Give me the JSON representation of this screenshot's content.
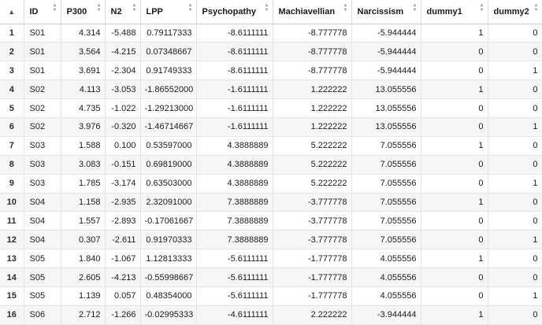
{
  "table": {
    "columns": [
      {
        "label": "",
        "icon": "sort-triangle-icon"
      },
      {
        "label": "ID"
      },
      {
        "label": "P300"
      },
      {
        "label": "N2"
      },
      {
        "label": "LPP"
      },
      {
        "label": "Psychopathy"
      },
      {
        "label": "Machiavellian"
      },
      {
        "label": "Narcissism"
      },
      {
        "label": "dummy1"
      },
      {
        "label": "dummy2"
      }
    ],
    "rows": [
      [
        "1",
        "S01",
        "4.314",
        "-5.488",
        "0.79117333",
        "-8.6111111",
        "-8.777778",
        "-5.944444",
        "1",
        "0"
      ],
      [
        "2",
        "S01",
        "3.564",
        "-4.215",
        "0.07348667",
        "-8.6111111",
        "-8.777778",
        "-5.944444",
        "0",
        "0"
      ],
      [
        "3",
        "S01",
        "3.691",
        "-2.304",
        "0.91749333",
        "-8.6111111",
        "-8.777778",
        "-5.944444",
        "0",
        "1"
      ],
      [
        "4",
        "S02",
        "4.113",
        "-3.053",
        "-1.86552000",
        "-1.6111111",
        "1.222222",
        "13.055556",
        "1",
        "0"
      ],
      [
        "5",
        "S02",
        "4.735",
        "-1.022",
        "-1.29213000",
        "-1.6111111",
        "1.222222",
        "13.055556",
        "0",
        "0"
      ],
      [
        "6",
        "S02",
        "3.976",
        "-0.320",
        "-1.46714667",
        "-1.6111111",
        "1.222222",
        "13.055556",
        "0",
        "1"
      ],
      [
        "7",
        "S03",
        "1.588",
        "0.100",
        "0.53597000",
        "4.3888889",
        "5.222222",
        "7.055556",
        "1",
        "0"
      ],
      [
        "8",
        "S03",
        "3.083",
        "-0.151",
        "0.69819000",
        "4.3888889",
        "5.222222",
        "7.055556",
        "0",
        "0"
      ],
      [
        "9",
        "S03",
        "1.785",
        "-3.174",
        "0.63503000",
        "4.3888889",
        "5.222222",
        "7.055556",
        "0",
        "1"
      ],
      [
        "10",
        "S04",
        "1.158",
        "-2.935",
        "2.32091000",
        "7.3888889",
        "-3.777778",
        "7.055556",
        "1",
        "0"
      ],
      [
        "11",
        "S04",
        "1.557",
        "-2.893",
        "-0.17061667",
        "7.3888889",
        "-3.777778",
        "7.055556",
        "0",
        "0"
      ],
      [
        "12",
        "S04",
        "0.307",
        "-2.611",
        "0.91970333",
        "7.3888889",
        "-3.777778",
        "7.055556",
        "0",
        "1"
      ],
      [
        "13",
        "S05",
        "1.840",
        "-1.067",
        "1.12813333",
        "-5.6111111",
        "-1.777778",
        "4.055556",
        "1",
        "0"
      ],
      [
        "14",
        "S05",
        "2.605",
        "-4.213",
        "-0.55998667",
        "-5.6111111",
        "-1.777778",
        "4.055556",
        "0",
        "0"
      ],
      [
        "15",
        "S05",
        "1.139",
        "0.057",
        "0.48354000",
        "-5.6111111",
        "-1.777778",
        "4.055556",
        "0",
        "1"
      ],
      [
        "16",
        "S06",
        "2.712",
        "-1.266",
        "-0.02995333",
        "-4.6111111",
        "2.222222",
        "-3.944444",
        "1",
        "0"
      ]
    ]
  },
  "colors": {
    "header_bg": "#ffffff",
    "row_alt_bg": "#f6f6f6",
    "grid_line": "#e4e4e4",
    "sort_arrow": "#9a9a9a"
  }
}
